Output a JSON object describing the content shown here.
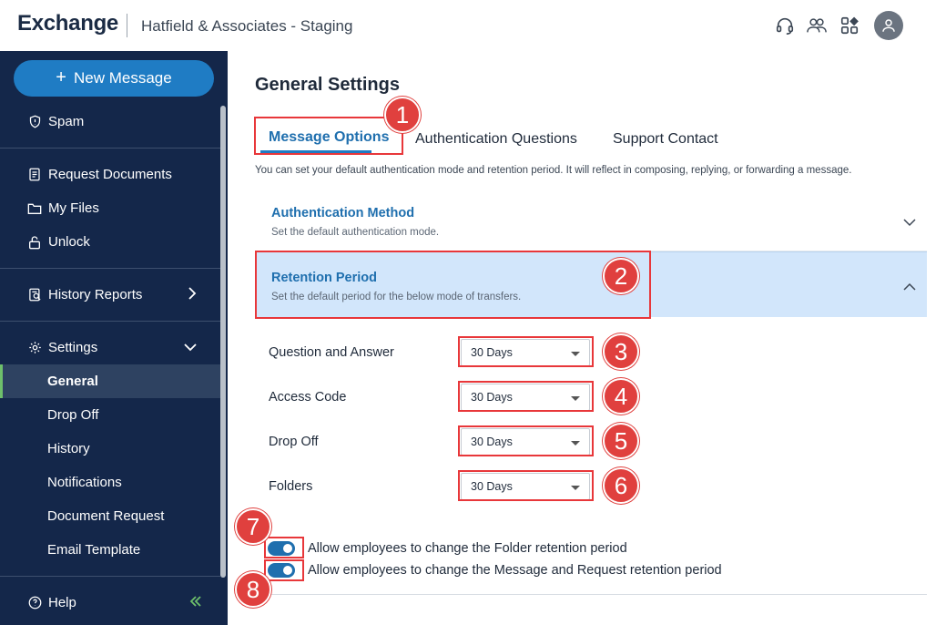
{
  "header": {
    "brand": "Exchange",
    "org": "Hatfield & Associates - Staging",
    "icons": [
      "headset-icon",
      "people-icon",
      "apps-icon",
      "user-avatar-icon"
    ]
  },
  "sidebar": {
    "new_message": "New Message",
    "items": [
      {
        "label": "Spam",
        "icon": "shield-icon"
      },
      {
        "label": "Request Documents",
        "icon": "document-icon"
      },
      {
        "label": "My Files",
        "icon": "folder-icon"
      },
      {
        "label": "Unlock",
        "icon": "unlock-icon"
      },
      {
        "label": "History Reports",
        "icon": "report-icon"
      },
      {
        "label": "Settings",
        "icon": "gear-icon"
      }
    ],
    "settings_sub": [
      "General",
      "Drop Off",
      "History",
      "Notifications",
      "Document Request",
      "Email Template"
    ],
    "help": "Help"
  },
  "main": {
    "title": "General Settings",
    "tabs": [
      "Message Options",
      "Authentication Questions",
      "Support Contact"
    ],
    "hint": "You can set your default authentication mode and retention period. It will reflect in composing, replying, or forwarding a message.",
    "auth_method": {
      "title": "Authentication Method",
      "subtitle": "Set the default authentication mode."
    },
    "retention": {
      "title": "Retention Period",
      "subtitle": "Set the default period for the below mode of transfers."
    },
    "rows": [
      {
        "label": "Question and Answer",
        "value": "30 Days"
      },
      {
        "label": "Access Code",
        "value": "30 Days"
      },
      {
        "label": "Drop Off",
        "value": "30 Days"
      },
      {
        "label": "Folders",
        "value": "30 Days"
      }
    ],
    "toggles": [
      {
        "label": "Allow employees to change the Folder retention period",
        "on": true
      },
      {
        "label": "Allow employees to change the Message and Request retention period",
        "on": true
      }
    ]
  },
  "callouts": [
    "1",
    "2",
    "3",
    "4",
    "5",
    "6",
    "7",
    "8"
  ],
  "colors": {
    "sidebar_bg": "#14274a",
    "accent": "#1f7cc4",
    "callout": "#e0403e",
    "retention_bg": "#d2e6fb"
  }
}
